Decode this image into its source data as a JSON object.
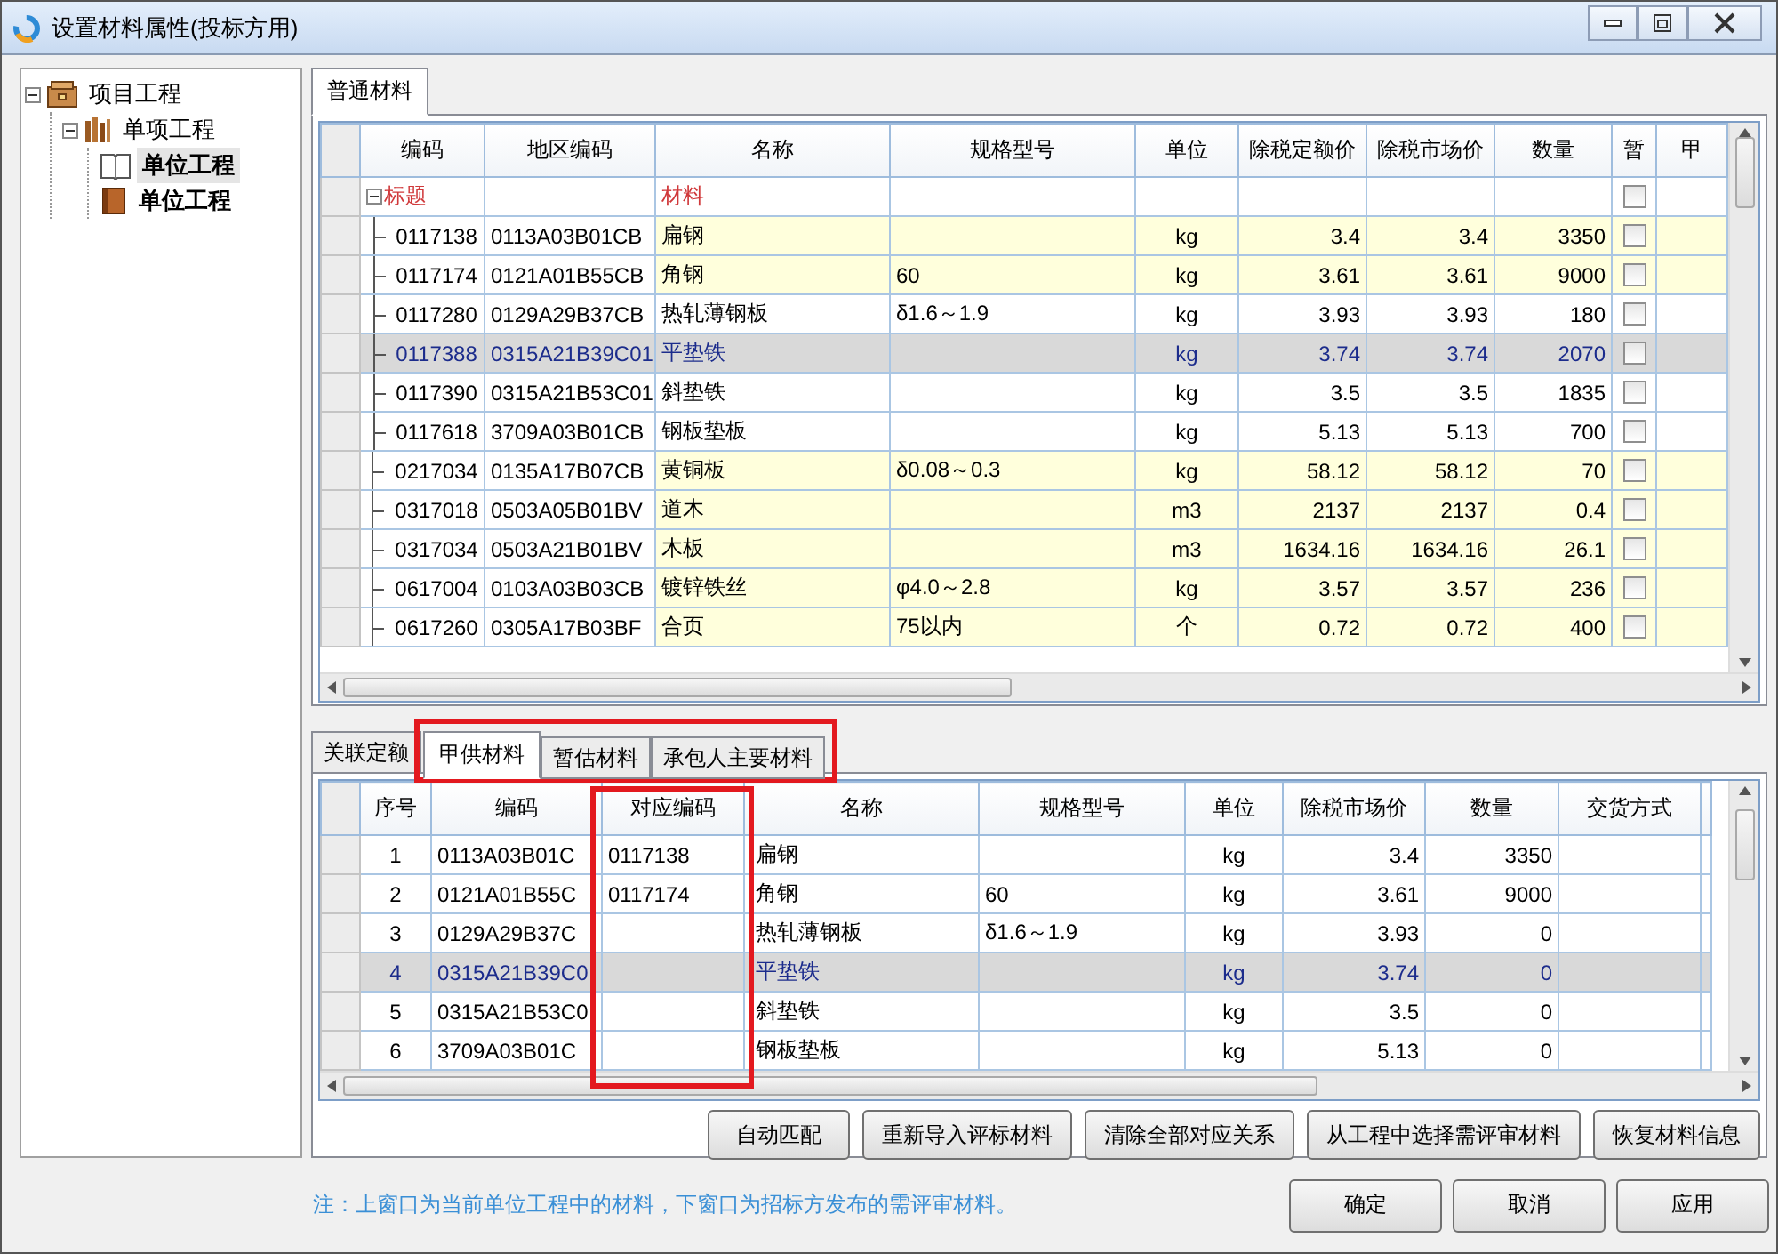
{
  "window": {
    "title": "设置材料属性(投标方用)"
  },
  "tree": [
    {
      "kind": "project",
      "label": "项目工程",
      "expanded": true,
      "selected": false,
      "children": [
        {
          "kind": "section",
          "label": "单项工程",
          "expanded": true,
          "selected": false,
          "children": [
            {
              "kind": "unit",
              "label": "单位工程",
              "selected": true
            },
            {
              "kind": "unit",
              "label": "单位工程",
              "selected": false
            }
          ]
        }
      ]
    }
  ],
  "upper_tabs": [
    {
      "label": "普通材料",
      "selected": true
    }
  ],
  "materials_table": {
    "columns": [
      "编码",
      "地区编码",
      "名称",
      "规格型号",
      "单位",
      "除税定额价",
      "除税市场价",
      "数量",
      "暂",
      "甲"
    ],
    "rows": [
      {
        "kind": "group",
        "expanded": true,
        "label": "标题",
        "name": "材料",
        "checked": false
      },
      {
        "kind": "item",
        "selected": false,
        "highlighted": true,
        "checked": false,
        "cells": [
          "0117138",
          "0113A03B01CB",
          "扁钢",
          null,
          "kg",
          "3.4",
          "3.4",
          "3350"
        ]
      },
      {
        "kind": "item",
        "selected": false,
        "highlighted": true,
        "checked": false,
        "cells": [
          "0117174",
          "0121A01B55CB",
          "角钢",
          "60",
          "kg",
          "3.61",
          "3.61",
          "9000"
        ]
      },
      {
        "kind": "item",
        "selected": false,
        "highlighted": false,
        "checked": false,
        "cells": [
          "0117280",
          "0129A29B37CB",
          "热轧薄钢板",
          "δ1.6～1.9",
          "kg",
          "3.93",
          "3.93",
          "180"
        ]
      },
      {
        "kind": "item",
        "selected": true,
        "highlighted": false,
        "checked": false,
        "cells": [
          "0117388",
          "0315A21B39C01",
          "平垫铁",
          null,
          "kg",
          "3.74",
          "3.74",
          "2070"
        ]
      },
      {
        "kind": "item",
        "selected": false,
        "highlighted": false,
        "checked": false,
        "cells": [
          "0117390",
          "0315A21B53C01",
          "斜垫铁",
          null,
          "kg",
          "3.5",
          "3.5",
          "1835"
        ]
      },
      {
        "kind": "item",
        "selected": false,
        "highlighted": false,
        "checked": false,
        "cells": [
          "0117618",
          "3709A03B01CB",
          "钢板垫板",
          null,
          "kg",
          "5.13",
          "5.13",
          "700"
        ]
      },
      {
        "kind": "item",
        "selected": false,
        "highlighted": true,
        "checked": false,
        "cells": [
          "0217034",
          "0135A17B07CB",
          "黄铜板",
          "δ0.08～0.3",
          "kg",
          "58.12",
          "58.12",
          "70"
        ]
      },
      {
        "kind": "item",
        "selected": false,
        "highlighted": true,
        "checked": false,
        "cells": [
          "0317018",
          "0503A05B01BV",
          "道木",
          null,
          "m3",
          "2137",
          "2137",
          "0.4"
        ]
      },
      {
        "kind": "item",
        "selected": false,
        "highlighted": true,
        "checked": false,
        "cells": [
          "0317034",
          "0503A21B01BV",
          "木板",
          null,
          "m3",
          "1634.16",
          "1634.16",
          "26.1"
        ]
      },
      {
        "kind": "item",
        "selected": false,
        "highlighted": true,
        "checked": false,
        "cells": [
          "0617004",
          "0103A03B03CB",
          "镀锌铁丝",
          "φ4.0～2.8",
          "kg",
          "3.57",
          "3.57",
          "236"
        ]
      },
      {
        "kind": "item",
        "selected": false,
        "highlighted": true,
        "checked": false,
        "cells": [
          "0617260",
          "0305A17B03BF",
          "合页",
          "75以内",
          "个",
          "0.72",
          "0.72",
          "400"
        ]
      }
    ]
  },
  "lower_tabs": [
    {
      "label": "关联定额",
      "selected": false
    },
    {
      "label": "甲供材料",
      "selected": true
    },
    {
      "label": "暂估材料",
      "selected": false
    },
    {
      "label": "承包人主要材料",
      "selected": false
    }
  ],
  "bid_table": {
    "columns": [
      "序号",
      "编码",
      "对应编码",
      "名称",
      "规格型号",
      "单位",
      "除税市场价",
      "数量",
      "交货方式"
    ],
    "rows": [
      {
        "selected": false,
        "cells": [
          "1",
          "0113A03B01C",
          "0117138",
          "扁钢",
          null,
          "kg",
          "3.4",
          "3350",
          null
        ]
      },
      {
        "selected": false,
        "cells": [
          "2",
          "0121A01B55C",
          "0117174",
          "角钢",
          "60",
          "kg",
          "3.61",
          "9000",
          null
        ]
      },
      {
        "selected": false,
        "cells": [
          "3",
          "0129A29B37C",
          null,
          "热轧薄钢板",
          "δ1.6～1.9",
          "kg",
          "3.93",
          "0",
          null
        ]
      },
      {
        "selected": true,
        "cells": [
          "4",
          "0315A21B39C0",
          null,
          "平垫铁",
          null,
          "kg",
          "3.74",
          "0",
          null
        ]
      },
      {
        "selected": false,
        "cells": [
          "5",
          "0315A21B53C0",
          null,
          "斜垫铁",
          null,
          "kg",
          "3.5",
          "0",
          null
        ]
      },
      {
        "selected": false,
        "cells": [
          "6",
          "3709A03B01C",
          null,
          "钢板垫板",
          null,
          "kg",
          "5.13",
          "0",
          null
        ]
      }
    ]
  },
  "action_buttons": [
    "自动匹配",
    "重新导入评标材料",
    "清除全部对应关系",
    "从工程中选择需评审材料",
    "恢复材料信息"
  ],
  "note": "注：上窗口为当前单位工程中的材料，下窗口为招标方发布的需评审材料。",
  "dialog_buttons": [
    "确定",
    "取消",
    "应用"
  ]
}
